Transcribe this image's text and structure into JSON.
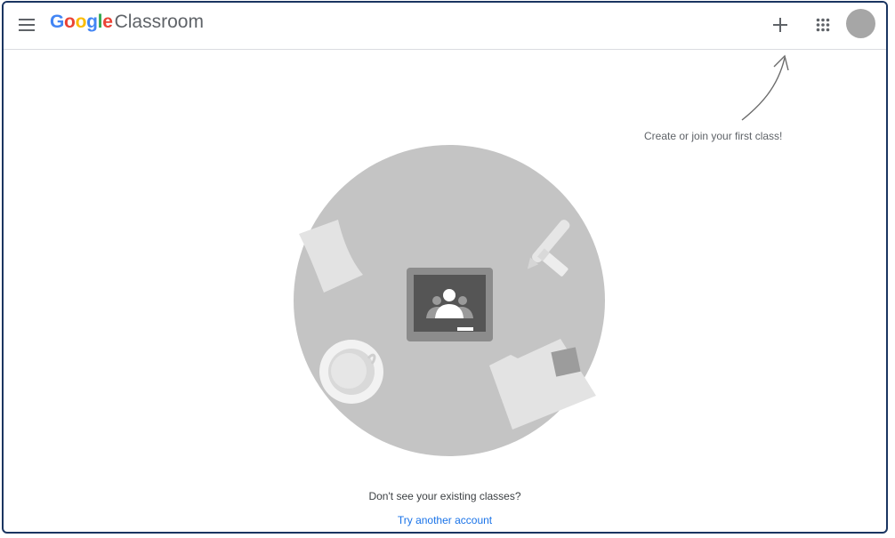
{
  "header": {
    "brand_google_letters": [
      {
        "ch": "G",
        "color": "#4285F4"
      },
      {
        "ch": "o",
        "color": "#EA4335"
      },
      {
        "ch": "o",
        "color": "#FBBC05"
      },
      {
        "ch": "g",
        "color": "#4285F4"
      },
      {
        "ch": "l",
        "color": "#34A853"
      },
      {
        "ch": "e",
        "color": "#EA4335"
      }
    ],
    "brand_product": "Classroom",
    "icons": {
      "menu": "hamburger-menu-icon",
      "create": "plus-icon",
      "apps": "google-apps-grid-icon",
      "account": "account-avatar"
    }
  },
  "hint": {
    "text": "Create or join your first class!"
  },
  "empty_state": {
    "message": "Don't see your existing classes?",
    "link_label": "Try another account"
  },
  "colors": {
    "link": "#1a73e8",
    "frame_border": "#1a3561",
    "avatar": "#a6a6a6"
  }
}
